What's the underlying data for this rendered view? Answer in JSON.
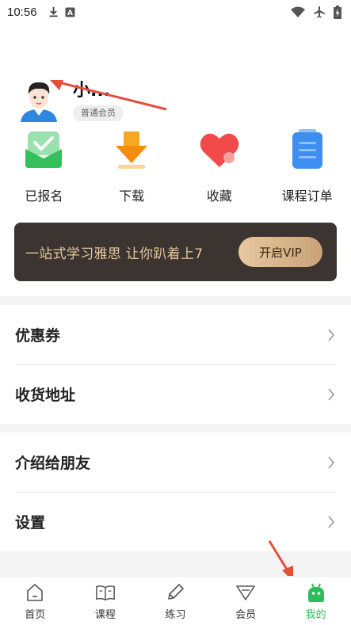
{
  "status_bar": {
    "time": "10:56",
    "left_icons": [
      "download-icon",
      "font-icon"
    ],
    "right_icons": [
      "wifi-icon",
      "airplane-icon",
      "battery-charging-icon"
    ]
  },
  "profile": {
    "username": "小...",
    "member_level": "普通会员",
    "avatar_icon": "avatar-icon"
  },
  "quick_menu": [
    {
      "label": "已报名",
      "icon": "enrolled-icon",
      "color": "#34c15c"
    },
    {
      "label": "下载",
      "icon": "download-icon",
      "color": "#f5a623"
    },
    {
      "label": "收藏",
      "icon": "heart-icon",
      "color": "#f04a4a"
    },
    {
      "label": "课程订单",
      "icon": "order-icon",
      "color": "#3d8ef0"
    }
  ],
  "vip_banner": {
    "text": "一站式学习雅思 让你趴着上7",
    "button_label": "开启VIP"
  },
  "menu_list": [
    {
      "label": "优惠券"
    },
    {
      "label": "收货地址"
    },
    {
      "label": "介绍给朋友"
    },
    {
      "label": "设置"
    }
  ],
  "bottom_nav": [
    {
      "label": "首页",
      "icon": "home-icon"
    },
    {
      "label": "课程",
      "icon": "book-icon"
    },
    {
      "label": "练习",
      "icon": "pencil-icon"
    },
    {
      "label": "会员",
      "icon": "diamond-icon"
    },
    {
      "label": "我的",
      "icon": "robot-icon",
      "active": true
    }
  ],
  "colors": {
    "accent": "#2ebd59",
    "vip_bg": "#3b3430",
    "vip_text": "#e3c69e",
    "annotation": "#e74c3c"
  }
}
